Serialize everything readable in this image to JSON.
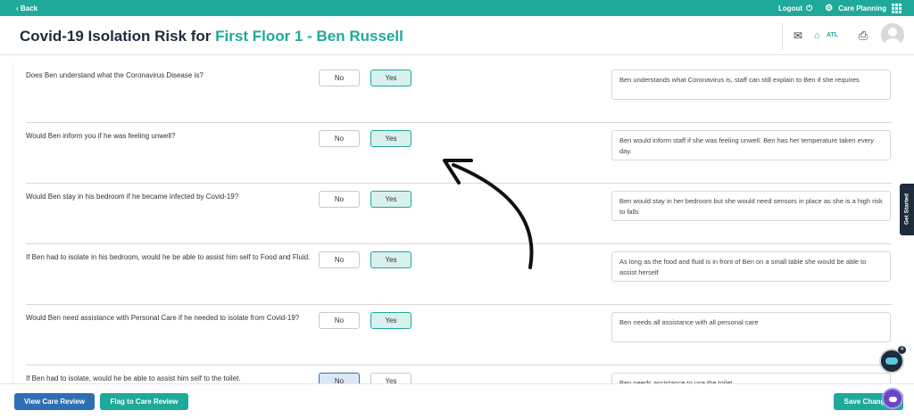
{
  "topbar": {
    "back": "‹ Back",
    "logout": "Logout",
    "care_planning": "Care Planning"
  },
  "header": {
    "title_prefix": "Covid-19 Isolation Risk  for ",
    "title_name": "First Floor 1 - Ben Russell",
    "location": "ATL"
  },
  "rows": [
    {
      "question": "Does Ben understand what the Coronavirus Disease is?",
      "no": "No",
      "yes": "Yes",
      "selected": "yes",
      "comment": "Ben understands what Coronavirus is, staff can still explain to Ben if she requires"
    },
    {
      "question": "Would Ben inform you if he was feeling unwell?",
      "no": "No",
      "yes": "Yes",
      "selected": "yes",
      "comment": "Ben would inform staff if she was feeling unwell. Ben has her temperature taken every day."
    },
    {
      "question": "Would Ben stay in his bedroom if he became infected by Covid-19?",
      "no": "No",
      "yes": "Yes",
      "selected": "yes",
      "comment": "Ben would stay in her bedroom but she would need sensors in place as she is a high risk to falls"
    },
    {
      "question": "If Ben had to isolate in his bedroom, would he be able to assist him self to Food and Fluid.",
      "no": "No",
      "yes": "Yes",
      "selected": "yes",
      "comment": "As long as the food and fluid is in front of Ben on a small table she would be able to assist herself"
    },
    {
      "question": "Would Ben need assistance with Personal Care if he needed to isolate from Covid-19?",
      "no": "No",
      "yes": "Yes",
      "selected": "yes",
      "comment": "Ben needs all assistance with all personal care"
    },
    {
      "question": "If Ben had to isolate, would he be able to assist him self to the toilet.",
      "no": "No",
      "yes": "Yes",
      "selected": "no",
      "comment": "Ben needs assistance to use the toilet"
    }
  ],
  "footer": {
    "view": "View Care Review",
    "flag": "Flag to Care Review",
    "save": "Save Changes"
  },
  "side_tab": "Get Started",
  "chat_badge": "4",
  "colors": {
    "brand": "#1fa99a",
    "primary": "#2e6fb3",
    "dark": "#1d2b3a"
  }
}
